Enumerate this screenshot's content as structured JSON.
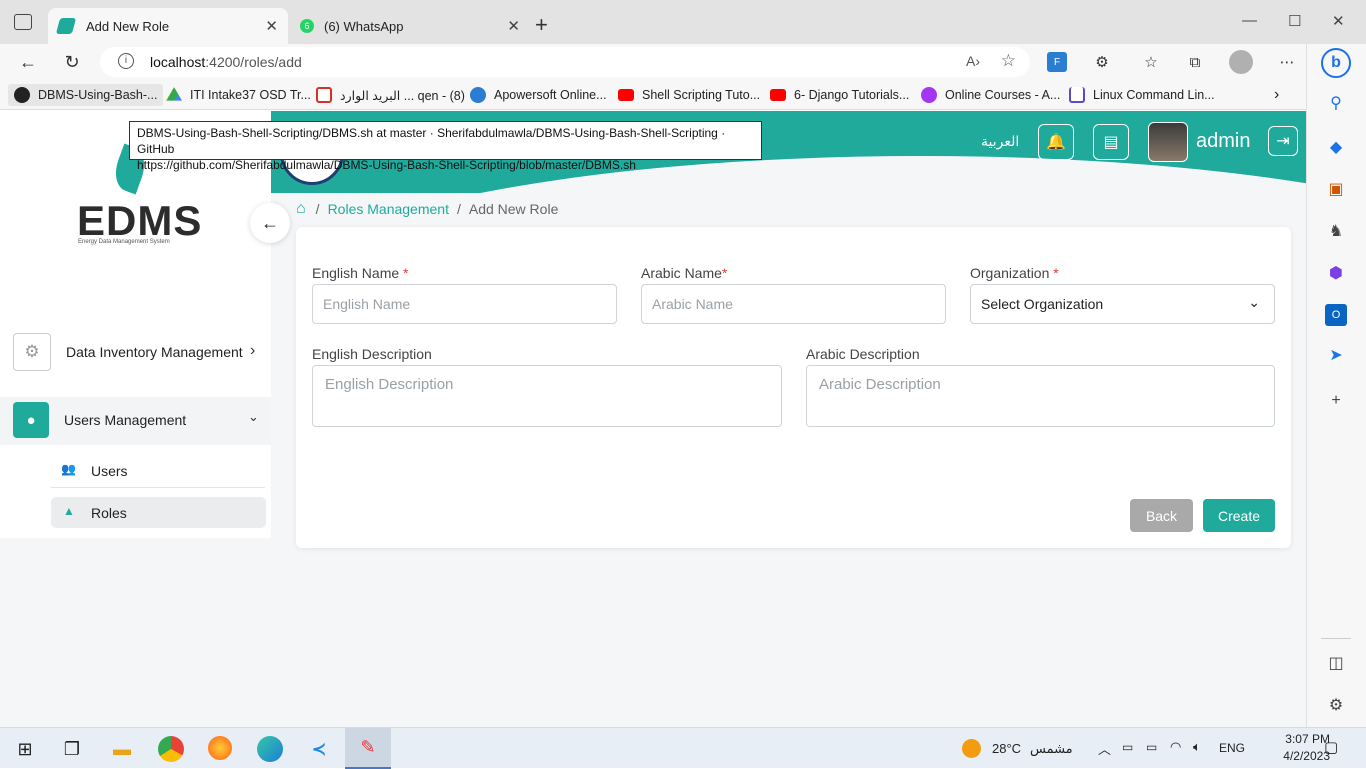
{
  "browser": {
    "tabs": [
      {
        "title": "Add New Role",
        "active": true
      },
      {
        "title": "(6) WhatsApp",
        "active": false,
        "badge": "6"
      }
    ],
    "new_tab": "+",
    "url_host": "localhost",
    "url_rest": ":4200/roles/add",
    "favorites": [
      {
        "label": "DBMS-Using-Bash-...",
        "icon": "github-icon",
        "color": "#222222"
      },
      {
        "label": "ITI Intake37 OSD Tr...",
        "icon": "google-drive-icon",
        "color": "#34a853"
      },
      {
        "label": "البريد الوارد ... qen - (8)",
        "icon": "gmail-icon",
        "color": "#d93025"
      },
      {
        "label": "Apowersoft Online...",
        "icon": "apowersoft-icon",
        "color": "#2b7cd3"
      },
      {
        "label": "Shell Scripting Tuto...",
        "icon": "youtube-icon",
        "color": "#ff0000"
      },
      {
        "label": "6- Django Tutorials...",
        "icon": "youtube-icon",
        "color": "#ff0000"
      },
      {
        "label": "Online Courses - A...",
        "icon": "udemy-icon",
        "color": "#a435f0"
      },
      {
        "label": "Linux Command Lin...",
        "icon": "linux-icon",
        "color": "#5b4cc4"
      }
    ],
    "tooltip_line1": "DBMS-Using-Bash-Shell-Scripting/DBMS.sh at master · Sherifabdulmawla/DBMS-Using-Bash-Shell-Scripting · GitHub",
    "tooltip_line2": "https://github.com/Sherifabdulmawla/DBMS-Using-Bash-Shell-Scripting/blob/master/DBMS.sh"
  },
  "app": {
    "logo_text": "EDMS",
    "logo_subtitle": "Energy Data Management System",
    "header": {
      "language": "العربية",
      "username": "admin"
    },
    "sidebar": {
      "items": [
        {
          "label": "Data Inventory Management",
          "icon": "gear-icon",
          "expanded": false
        },
        {
          "label": "Users Management",
          "icon": "user-icon",
          "expanded": true
        }
      ],
      "subitems": [
        {
          "label": "Users",
          "icon": "users-icon",
          "active": false
        },
        {
          "label": "Roles",
          "icon": "user-tie-icon",
          "active": true
        }
      ]
    },
    "breadcrumb": {
      "parent": "Roles Management",
      "separator": "/",
      "current": "Add New Role"
    },
    "form": {
      "english_name": {
        "label": "English Name",
        "required_mark": "*",
        "placeholder": "English Name",
        "value": ""
      },
      "arabic_name": {
        "label": "Arabic Name",
        "required_mark": "*",
        "placeholder": "Arabic Name",
        "value": ""
      },
      "organization": {
        "label": "Organization",
        "required_mark": "*",
        "selected": "Select Organization"
      },
      "english_description": {
        "label": "English Description",
        "placeholder": "English Description",
        "value": ""
      },
      "arabic_description": {
        "label": "Arabic Description",
        "placeholder": "Arabic Description",
        "value": ""
      },
      "back_label": "Back",
      "create_label": "Create"
    },
    "colors": {
      "primary": "#1faa9c",
      "back_button": "#a9a9a9",
      "required": "#e53935"
    }
  },
  "taskbar": {
    "weather_temp": "28°C",
    "weather_text": "مشمس",
    "language": "ENG",
    "time": "3:07 PM",
    "date": "4/2/2023"
  }
}
